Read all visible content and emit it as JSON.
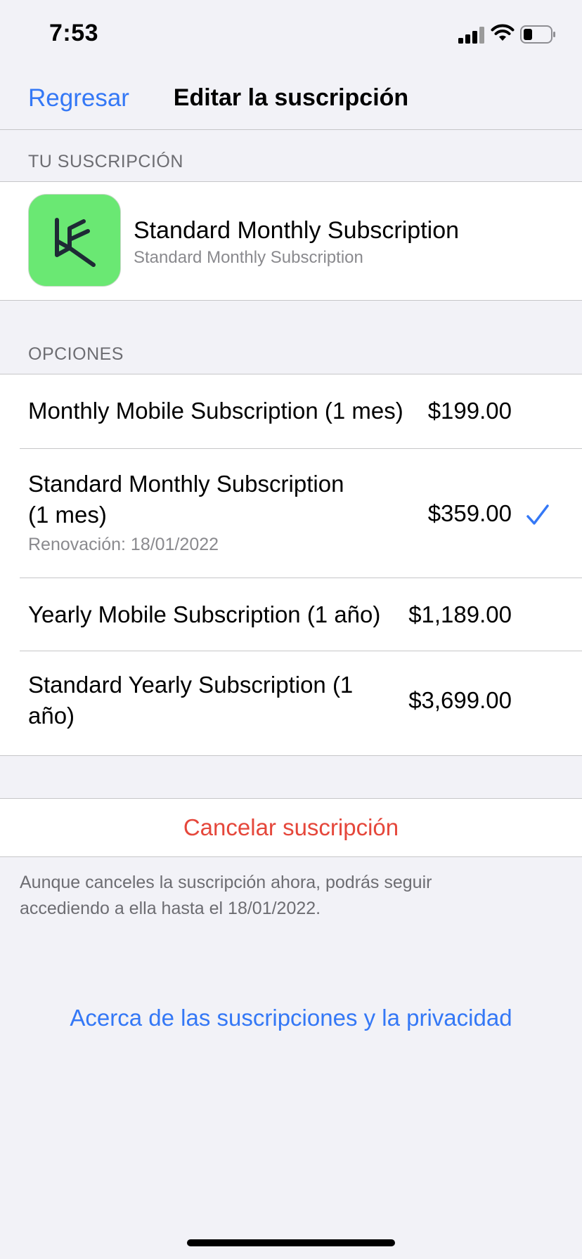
{
  "status_bar": {
    "time": "7:53"
  },
  "nav": {
    "back_label": "Regresar",
    "title": "Editar la suscripción"
  },
  "subscription_section": {
    "header": "TU SUSCRIPCIÓN",
    "title": "Standard Monthly Subscription",
    "subtitle": "Standard Monthly Subscription",
    "app_icon_color": "#6ae873"
  },
  "options_section": {
    "header": "OPCIONES",
    "options": [
      {
        "label": "Monthly Mobile Subscription (1 mes)",
        "price": "$199.00",
        "meta": ""
      },
      {
        "label_line1": "Standard Monthly Subscription",
        "label_line2": "(1 mes)",
        "price": "$359.00",
        "meta": "Renovación: 18/01/2022",
        "selected": true
      },
      {
        "label": "Yearly Mobile Subscription (1 año)",
        "price": "$1,189.00",
        "meta": ""
      },
      {
        "label_line1": "Standard Yearly Subscription (1",
        "label_line2": "año)",
        "price": "$3,699.00",
        "meta": ""
      }
    ]
  },
  "cancel": {
    "label": "Cancelar suscripción",
    "note_line1": "Aunque canceles la suscripción ahora, podrás seguir",
    "note_line2": "accediendo a ella hasta el 18/01/2022."
  },
  "footer": {
    "privacy_link": "Acerca de las suscripciones y la privacidad"
  },
  "colors": {
    "accent": "#3478f6",
    "destructive": "#e5473b",
    "background": "#f2f2f7"
  }
}
